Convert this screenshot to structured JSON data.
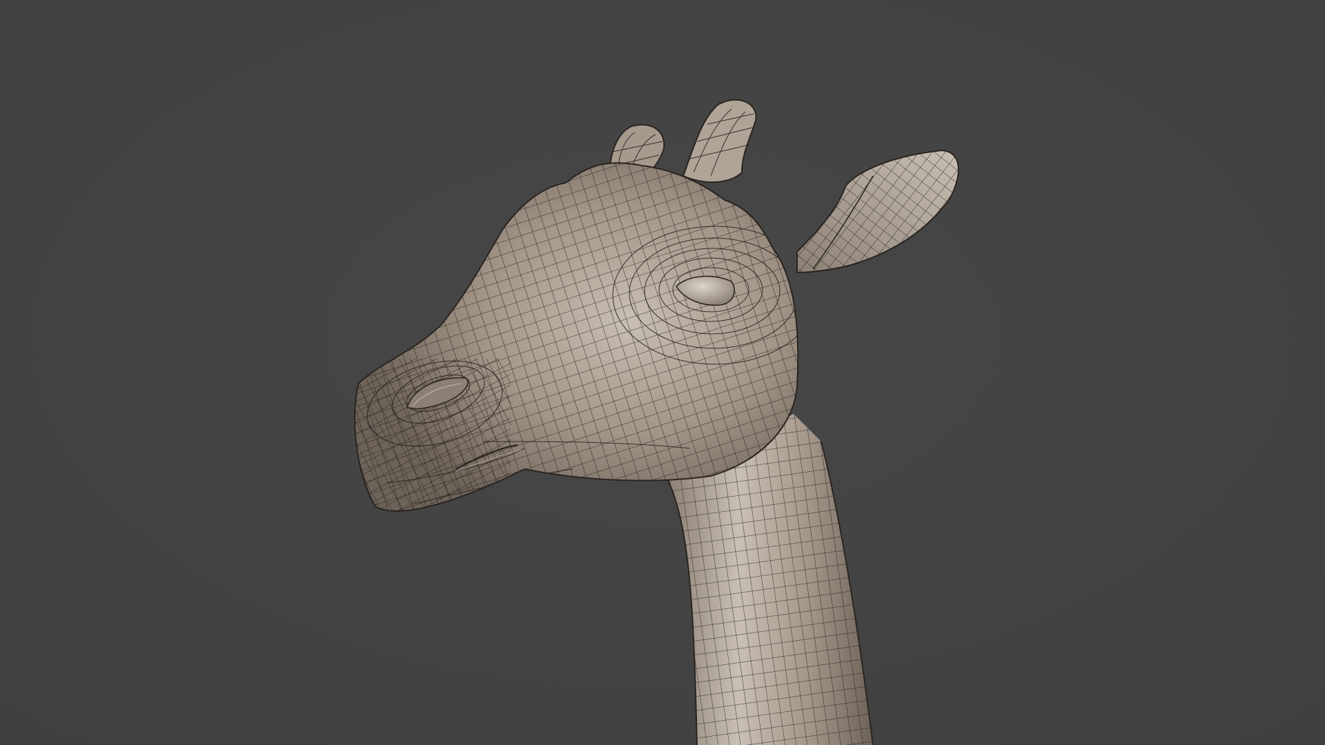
{
  "scene": {
    "background_color": "#474747",
    "background_vignette_color": "#404040",
    "mesh_color": "#a39587",
    "mesh_highlight_color": "#c9bfb3",
    "mesh_shadow_color": "#6e6359",
    "wire_color": "#1e1a17",
    "subject": "giraffe-head-wireframe-mesh"
  }
}
